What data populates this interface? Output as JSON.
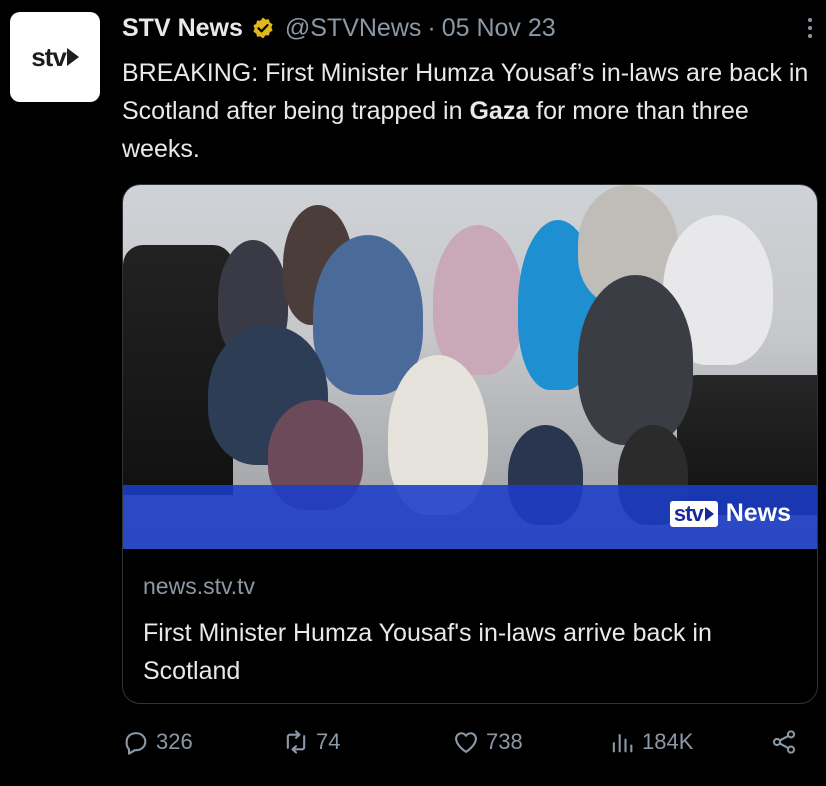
{
  "author": {
    "display_name": "STV News",
    "handle": "@STVNews",
    "separator": "·",
    "date": "05 Nov 23",
    "avatar_text": "stv"
  },
  "tweet": {
    "text_before": "BREAKING: First Minister Humza Yousaf’s in-laws are back in Scotland after being trapped in ",
    "text_bold": "Gaza",
    "text_after": " for more than three weeks."
  },
  "card": {
    "banner_brand": "stv",
    "banner_label": "News",
    "domain": "news.stv.tv",
    "title": "First Minister Humza Yousaf's in-laws arrive back in Scotland"
  },
  "actions": {
    "replies": "326",
    "reposts": "74",
    "likes": "738",
    "views": "184K"
  },
  "colors": {
    "background": "#000000",
    "text": "#e7e9ea",
    "secondary": "#8b98a5",
    "verified_badge": "#e2b719",
    "banner": "#1b3cc8"
  },
  "icons": [
    "more-options-icon",
    "verified-badge-icon",
    "reply-icon",
    "repost-icon",
    "like-icon",
    "views-icon",
    "share-icon"
  ]
}
